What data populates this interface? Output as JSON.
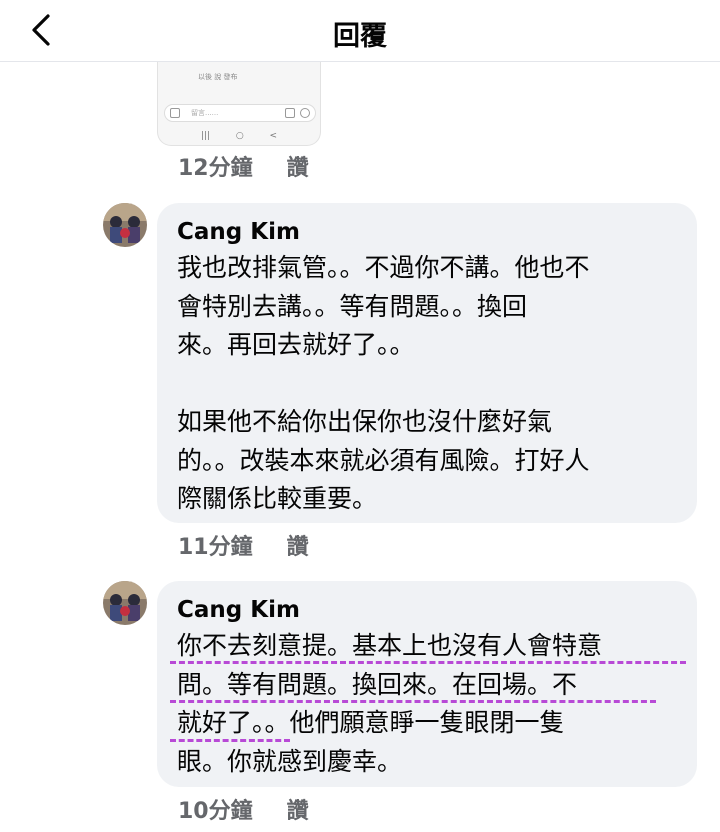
{
  "header": {
    "title": "回覆",
    "back_icon": "chevron-left-icon"
  },
  "thumbnail": {
    "row_text": "以後    說    發布",
    "input_placeholder": "留言......",
    "nav": [
      "|||",
      "○",
      "<"
    ]
  },
  "comments": [
    {
      "time": "12分鐘",
      "like": "讚"
    },
    {
      "author": "Cang Kim",
      "text": "我也改排氣管。。不過你不講。他也不\n會特別去講。。等有問題。。換回\n來。再回去就好了。。\n\n如果他不給你出保你也沒什麼好氣\n的。。改裝本來就必須有風險。打好人\n際關係比較重要。",
      "time": "11分鐘",
      "like": "讚"
    },
    {
      "author": "Cang Kim",
      "text": "你不去刻意提。基本上也沒有人會特意\n問。等有問題。換回來。在回場。不\n就好了。。他們願意睜一隻眼閉一隻\n眼。你就感到慶幸。",
      "time": "10分鐘",
      "like": "讚"
    }
  ],
  "colors": {
    "bubble": "#f0f2f5",
    "meta": "#65676b",
    "annotation": "#b84ad6"
  }
}
